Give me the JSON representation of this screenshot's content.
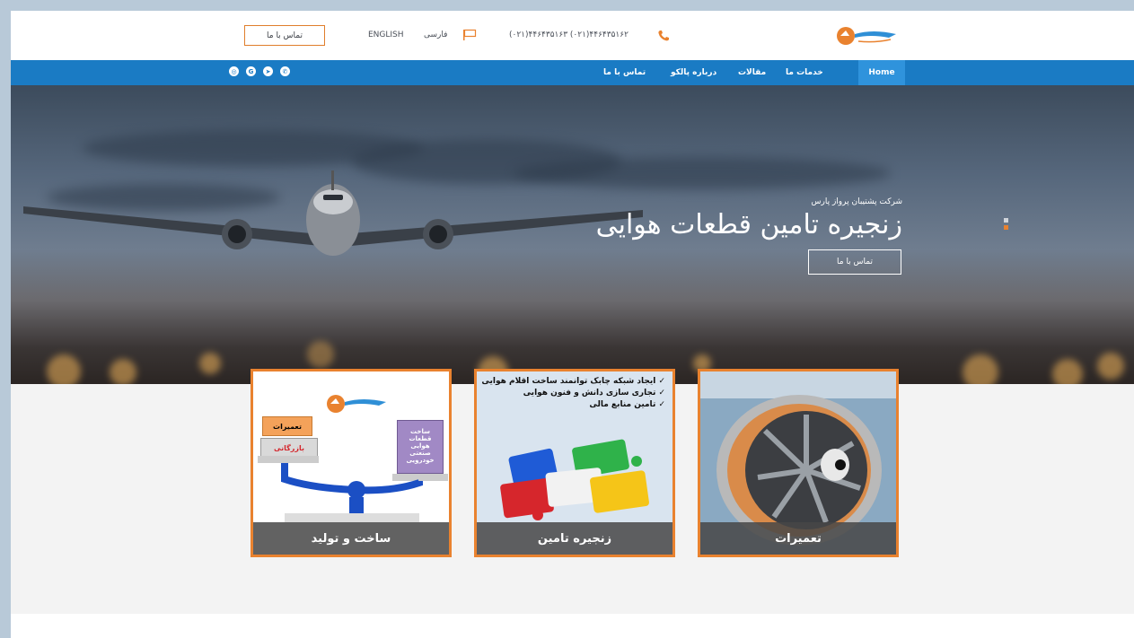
{
  "topbar": {
    "phones": "(۰۲۱)۴۴۶۴۳۵۱۶۳ (۰۲۱)۴۴۶۴۳۵۱۶۲",
    "lang_fa": "فارسی",
    "lang_en": "ENGLISH",
    "contact_label": "تماس با ما"
  },
  "nav": {
    "items": [
      "Home",
      "خدمات ما",
      "مقالات",
      "درباره پالکو",
      "تماس با ما"
    ],
    "social": [
      "instagram-icon",
      "google-icon",
      "telegram-icon",
      "whatsapp-icon"
    ]
  },
  "hero": {
    "subtitle": "شرکت پشتیبان پرواز پارس",
    "title": "زنجیره تامین قطعات هوایی",
    "button": "تماس با ما"
  },
  "cards": [
    {
      "caption": "ساخت و تولید",
      "labels": [
        "تعمیرات",
        "بازرگانی",
        "ساخت قطعات هوایی صنعتی خودرویی"
      ]
    },
    {
      "caption": "زنجیره تامین",
      "bullets": [
        "✓ ایجاد شبکه چابک توانمند ساخت اقلام هوایی",
        "✓ تجاری سازی دانش و فنون هوایی",
        "✓ تامین منابع مالی"
      ]
    },
    {
      "caption": "تعمیرات"
    }
  ],
  "colors": {
    "accent": "#e9822f",
    "nav_bg": "#1a7bc4",
    "nav_active": "#2f93dc"
  }
}
